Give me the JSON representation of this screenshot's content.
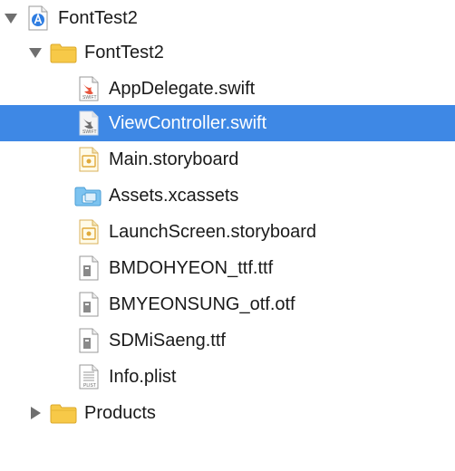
{
  "navigator": {
    "project": {
      "label": "FontTest2",
      "icon": "xcode-project-icon"
    },
    "group": {
      "label": "FontTest2",
      "icon": "folder-icon"
    },
    "files": [
      {
        "label": "AppDelegate.swift",
        "icon": "swift-file-icon",
        "badge": "SWIFT"
      },
      {
        "label": "ViewController.swift",
        "icon": "swift-file-icon",
        "badge": "SWIFT",
        "selected": true
      },
      {
        "label": "Main.storyboard",
        "icon": "storyboard-file-icon"
      },
      {
        "label": "Assets.xcassets",
        "icon": "asset-catalog-icon"
      },
      {
        "label": "LaunchScreen.storyboard",
        "icon": "storyboard-file-icon"
      },
      {
        "label": "BMDOHYEON_ttf.ttf",
        "icon": "font-file-icon"
      },
      {
        "label": "BMYEONSUNG_otf.otf",
        "icon": "font-file-icon"
      },
      {
        "label": "SDMiSaeng.ttf",
        "icon": "font-file-icon"
      },
      {
        "label": "Info.plist",
        "icon": "plist-file-icon",
        "badge": "PLIST"
      }
    ],
    "products": {
      "label": "Products",
      "icon": "folder-icon"
    }
  },
  "colors": {
    "selection": "#3e88e5",
    "folder": "#f7c948",
    "swift": "#e8553d",
    "storyboard_accent": "#e0a93a",
    "asset_folder": "#5fb0e8"
  }
}
